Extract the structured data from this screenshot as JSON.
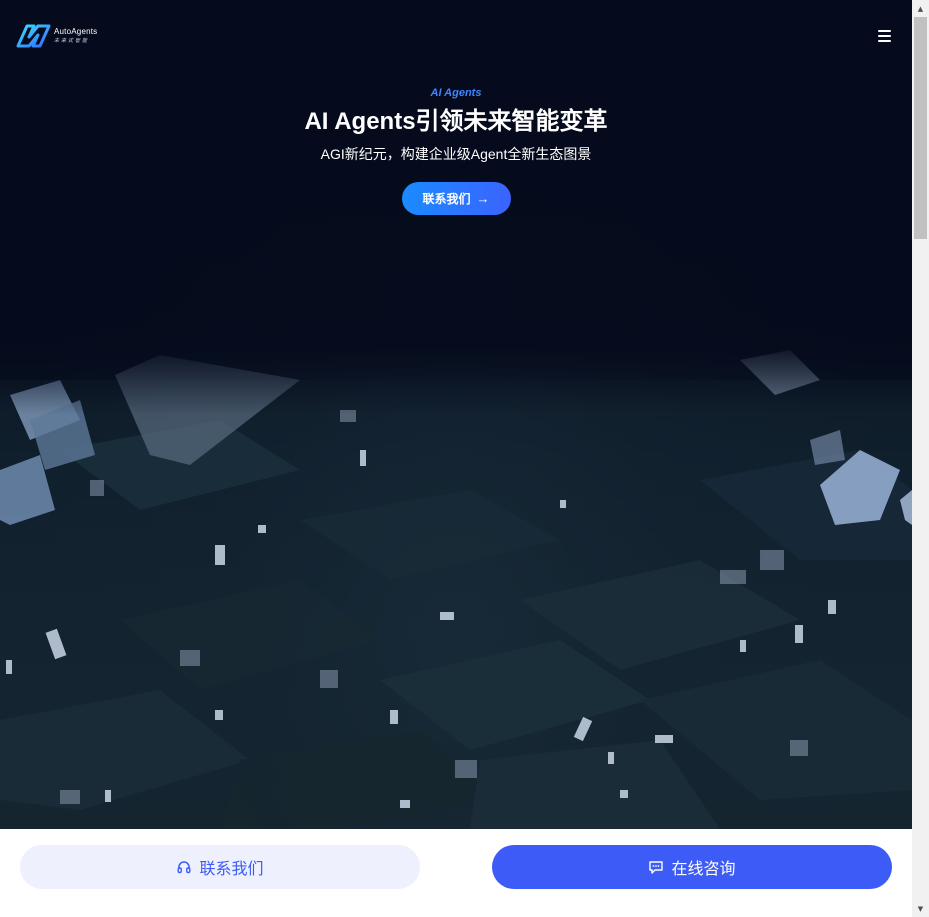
{
  "header": {
    "logo_name": "AutoAgents",
    "logo_tagline": "未来式智能",
    "menu_icon": "hamburger-menu-icon"
  },
  "hero": {
    "eyebrow": "AI Agents",
    "title": "AI Agents引领未来智能变革",
    "subtitle": "AGI新纪元，构建企业级Agent全新生态图景",
    "cta_label": "联系我们",
    "cta_icon": "arrow-right-icon"
  },
  "bottom_bar": {
    "contact_label": "联系我们",
    "contact_icon": "headset-icon",
    "chat_label": "在线咨询",
    "chat_icon": "chat-bubble-icon"
  },
  "colors": {
    "accent": "#3d5bf6",
    "eyebrow": "#3d86ff",
    "background": "#050b1c"
  }
}
